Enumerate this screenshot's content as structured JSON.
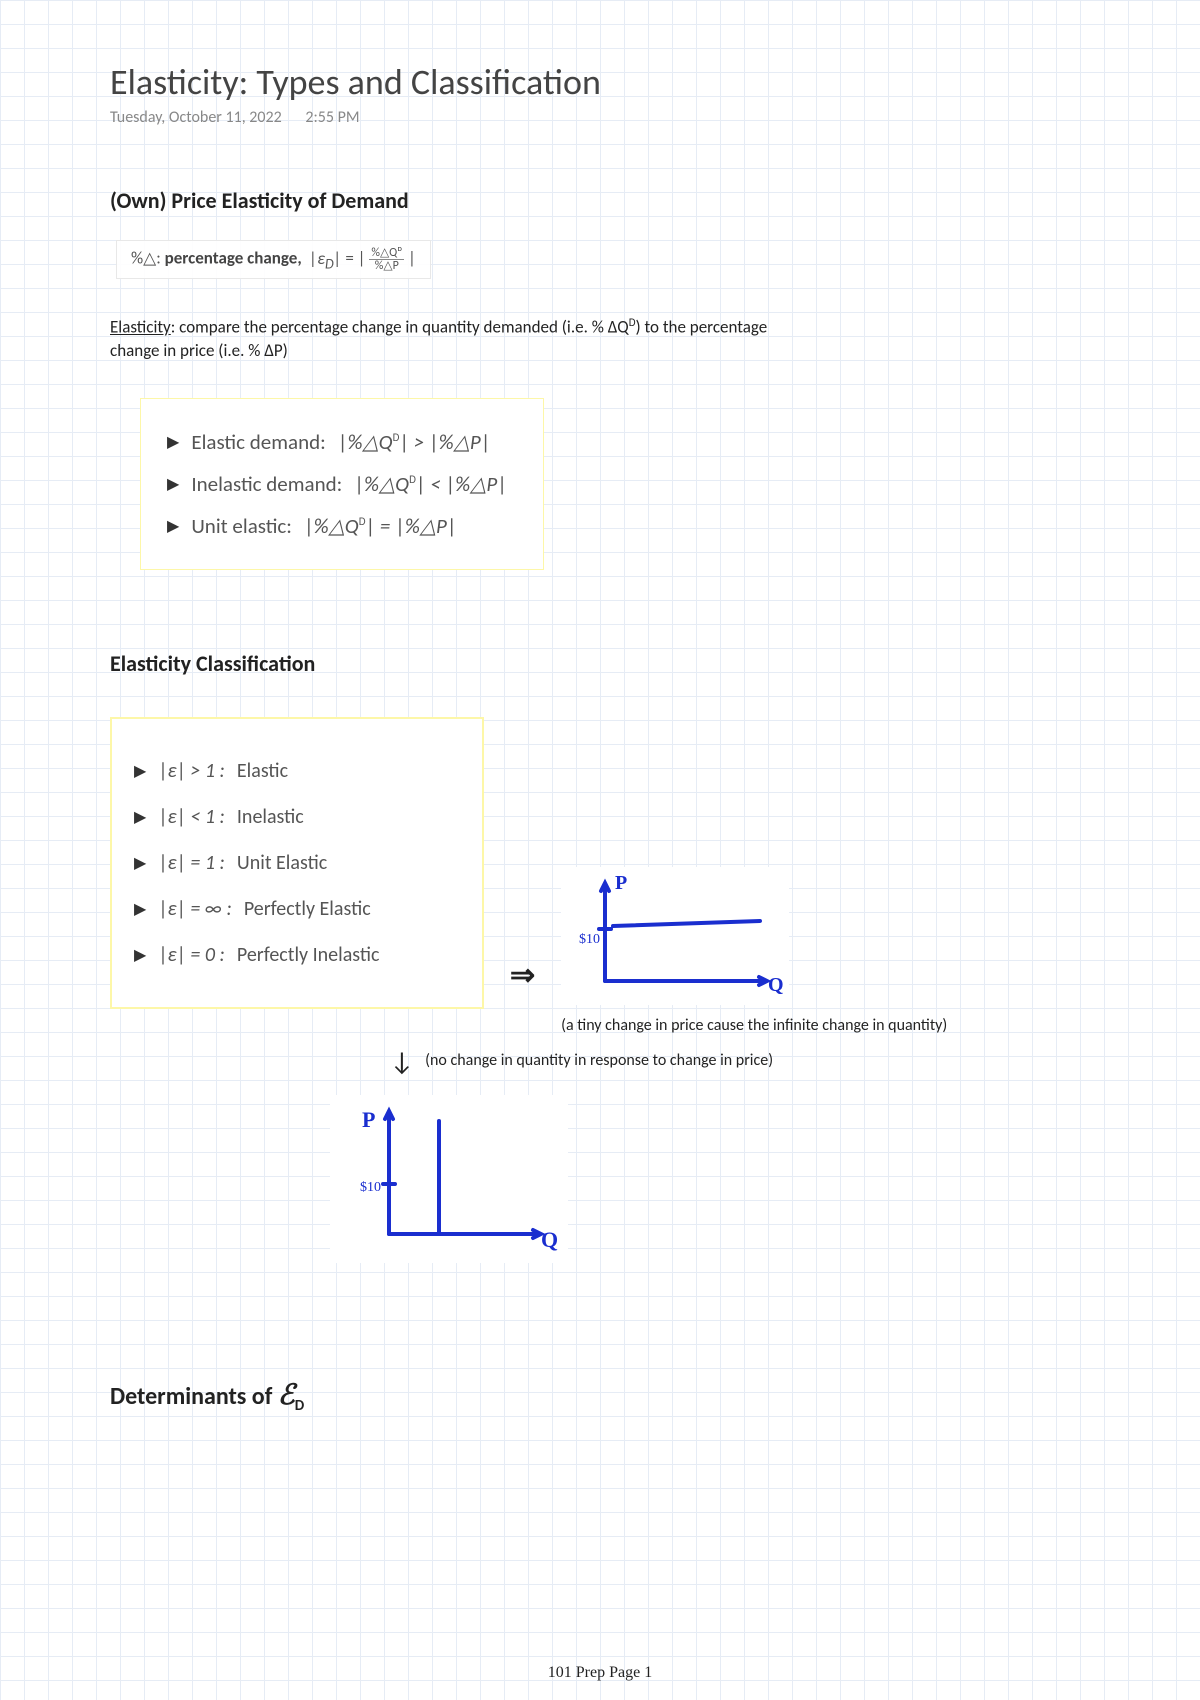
{
  "title": "Elasticity: Types and Classification",
  "date": "Tuesday, October 11, 2022",
  "time": "2:55 PM",
  "section1": {
    "heading": "(Own) Price Elasticity of Demand",
    "formula_prefix": "%△: ",
    "formula_label": "percentage change,",
    "formula_lhs": "|ε_D| = ",
    "formula_num": "%△Qᴰ",
    "formula_den": "%△P",
    "para_lead": "Elasticity",
    "para_rest1": ": compare the percentage change in quantity demanded (i.e. % ΔQ",
    "para_sup": "D",
    "para_rest2": ") to the percentage change in price (i.e. % ΔP)"
  },
  "elastic_rules": [
    {
      "label": "Elastic demand:",
      "rel": "|%△Qᴰ| > |%△P|"
    },
    {
      "label": "Inelastic demand:",
      "rel": "|%△Qᴰ| < |%△P|"
    },
    {
      "label": "Unit elastic:",
      "rel": "|%△Qᴰ| = |%△P|"
    }
  ],
  "section2_heading": "Elasticity Classification",
  "class_rules": [
    {
      "expr": "|ε| > 1 :",
      "name": "Elastic"
    },
    {
      "expr": "|ε| < 1 :",
      "name": "Inelastic"
    },
    {
      "expr": "|ε| = 1 :",
      "name": "Unit Elastic"
    },
    {
      "expr": "|ε| = ∞ :",
      "name": "Perfectly Elastic"
    },
    {
      "expr": "|ε| = 0 :",
      "name": "Perfectly Inelastic"
    }
  ],
  "arrow_right": "⇒",
  "caption_pe": "(a tiny change in price cause the infinite change in quantity)",
  "arrow_down": "↓",
  "caption_pi": "(no change in quantity in response to change in price)",
  "graph_labels": {
    "p": "P",
    "q": "Q",
    "tick": "$10"
  },
  "section3_heading_pre": "Determinants of ",
  "section3_symbol": "ℰ",
  "section3_sub": "D",
  "footer": "101 Prep Page 1"
}
